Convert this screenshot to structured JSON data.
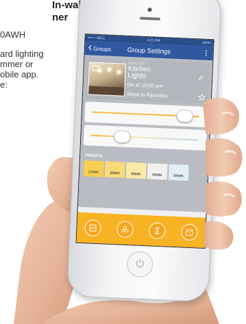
{
  "background_text": {
    "heading_line1": "In-wall",
    "heading_line2": "ner",
    "line1": "0AWH",
    "line2": "ard lighting",
    "line3": "mmer or",
    "line4": "obile app.",
    "line5": "e:"
  },
  "status_bar": {
    "carrier": "•••○○ BELL",
    "time": "4:21 PM",
    "battery": "100%"
  },
  "nav": {
    "back_label": "Groups",
    "title": "Group Settings",
    "more_glyph": "⋮"
  },
  "group": {
    "section_label": "GROUP",
    "name": "Kitchen Lights",
    "status": "On at 10:00 pm",
    "favorites_label": "Show in Favorites"
  },
  "sliders": {
    "brightness_level": 0.92,
    "temperature_level": 0.25
  },
  "presets": {
    "label": "PRESETS",
    "items": [
      {
        "label": "2700K",
        "color": "#f9cf52"
      },
      {
        "label": "3000K",
        "color": "#f8da78"
      },
      {
        "label": "3500K",
        "color": "#fbeaa7"
      },
      {
        "label": "4000K",
        "color": "#f1f2ee"
      },
      {
        "label": "5000K",
        "color": "#e2eef6"
      }
    ]
  },
  "bottom_icons": [
    "scene-icon",
    "groups-icon",
    "timer-icon",
    "schedule-icon"
  ],
  "colors": {
    "nav_blue": "#2f58a0",
    "accent_yellow": "#f7b324",
    "panel_gray": "#b9bcc2"
  }
}
